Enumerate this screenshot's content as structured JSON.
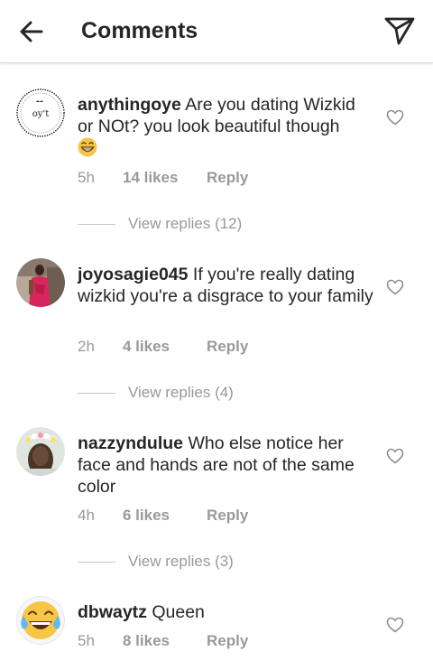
{
  "header": {
    "title": "Comments",
    "back_icon": "arrow-left-icon",
    "share_icon": "paper-plane-icon"
  },
  "comments": [
    {
      "username": "anythingoye",
      "text": "Are you dating Wizkid or NOt? you  look beautiful though",
      "emoji": "grinning-face-icon",
      "time": "5h",
      "likes": "14 likes",
      "reply": "Reply",
      "view_replies": "View replies (12)"
    },
    {
      "username": "joyosagie045",
      "text": "If you're really dating wizkid you're a disgrace to your family",
      "time": "2h",
      "likes": "4 likes",
      "reply": "Reply",
      "view_replies": "View replies (4)"
    },
    {
      "username": "nazzyndulue",
      "text": "Who else notice her face and hands are not of the same color",
      "time": "4h",
      "likes": "6 likes",
      "reply": "Reply",
      "view_replies": "View replies (3)"
    },
    {
      "username": "dbwaytz",
      "text": "Queen",
      "time": "5h",
      "likes": "8 likes",
      "reply": "Reply"
    }
  ],
  "colors": {
    "text": "#262626",
    "muted": "#999999",
    "divider": "#dbdbdb"
  }
}
